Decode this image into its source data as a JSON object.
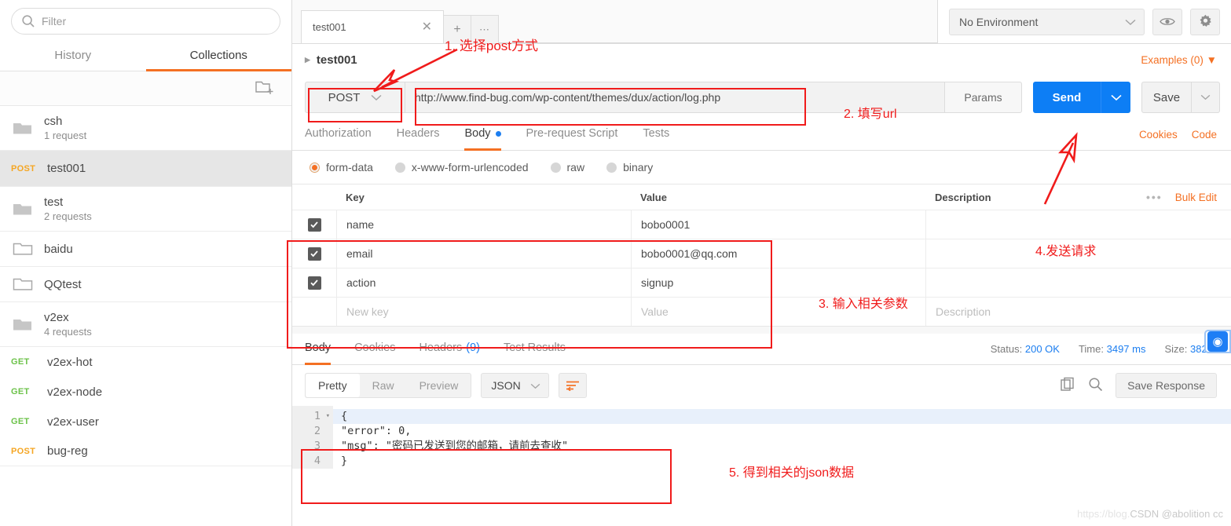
{
  "sidebar": {
    "filter_placeholder": "Filter",
    "tabs": [
      {
        "label": "History",
        "active": false
      },
      {
        "label": "Collections",
        "active": true
      }
    ],
    "new_folder_icon": "new-folder-icon",
    "items": [
      {
        "type": "folder",
        "name": "csh",
        "sub": "1 request"
      },
      {
        "type": "request",
        "method": "POST",
        "name": "test001",
        "selected": true
      },
      {
        "type": "folder",
        "name": "test",
        "sub": "2 requests"
      },
      {
        "type": "folder",
        "name": "baidu",
        "sub": ""
      },
      {
        "type": "folder",
        "name": "QQtest",
        "sub": ""
      },
      {
        "type": "folder",
        "name": "v2ex",
        "sub": "4 requests"
      },
      {
        "type": "request",
        "method": "GET",
        "name": "v2ex-hot",
        "selected": false
      },
      {
        "type": "request",
        "method": "GET",
        "name": "v2ex-node",
        "selected": false
      },
      {
        "type": "request",
        "method": "GET",
        "name": "v2ex-user",
        "selected": false
      },
      {
        "type": "request",
        "method": "POST",
        "name": "bug-reg",
        "selected": false
      }
    ]
  },
  "topbar": {
    "tab_label": "test001",
    "close_icon": "close-icon",
    "new_tab_icon": "plus-icon",
    "more_tabs_icon": "ellipsis-icon",
    "environment": "No Environment",
    "eye_icon": "eye-icon",
    "settings_icon": "gear-icon"
  },
  "request": {
    "breadcrumb": "test001",
    "examples_label": "Examples (0)",
    "method": "POST",
    "url": "http://www.find-bug.com/wp-content/themes/dux/action/log.php",
    "params_label": "Params",
    "send_label": "Send",
    "save_label": "Save",
    "tabs": [
      {
        "label": "Authorization",
        "active": false,
        "dot": false
      },
      {
        "label": "Headers",
        "active": false,
        "dot": false
      },
      {
        "label": "Body",
        "active": true,
        "dot": true
      },
      {
        "label": "Pre-request Script",
        "active": false,
        "dot": false
      },
      {
        "label": "Tests",
        "active": false,
        "dot": false
      }
    ],
    "right_links": [
      "Cookies",
      "Code"
    ],
    "body_types": [
      {
        "label": "form-data",
        "selected": true
      },
      {
        "label": "x-www-form-urlencoded",
        "selected": false
      },
      {
        "label": "raw",
        "selected": false
      },
      {
        "label": "binary",
        "selected": false
      }
    ],
    "table": {
      "headers": [
        "Key",
        "Value",
        "Description"
      ],
      "more_icon": "ellipsis-icon",
      "bulk_edit_label": "Bulk Edit",
      "rows": [
        {
          "checked": true,
          "key": "name",
          "value": "bobo0001",
          "description": ""
        },
        {
          "checked": true,
          "key": "email",
          "value": "bobo0001@qq.com",
          "description": ""
        },
        {
          "checked": true,
          "key": "action",
          "value": "signup",
          "description": ""
        }
      ],
      "new_row": {
        "key_placeholder": "New key",
        "value_placeholder": "Value",
        "desc_placeholder": "Description"
      }
    }
  },
  "response": {
    "tabs": [
      {
        "label": "Body",
        "active": true,
        "count": ""
      },
      {
        "label": "Cookies",
        "active": false,
        "count": ""
      },
      {
        "label": "Headers",
        "active": false,
        "count": "(9)"
      },
      {
        "label": "Test Results",
        "active": false,
        "count": ""
      }
    ],
    "status_label": "Status:",
    "status_value": "200 OK",
    "time_label": "Time:",
    "time_value": "3497 ms",
    "size_label": "Size:",
    "size_value": "382 B",
    "view_modes": [
      {
        "label": "Pretty",
        "active": true
      },
      {
        "label": "Raw",
        "active": false
      },
      {
        "label": "Preview",
        "active": false
      }
    ],
    "format": "JSON",
    "wrap_icon": "wrap-lines-icon",
    "copy_icon": "copy-icon",
    "search_icon": "search-icon",
    "save_response_label": "Save Response",
    "body_lines": [
      {
        "num": "1",
        "fold": true,
        "text": "{"
      },
      {
        "num": "2",
        "fold": false,
        "text": "    \"error\": 0,"
      },
      {
        "num": "3",
        "fold": false,
        "text": "    \"msg\": \"密码已发送到您的邮箱，请前去查收\""
      },
      {
        "num": "4",
        "fold": false,
        "text": "}"
      }
    ]
  },
  "annotations": [
    {
      "id": "a1",
      "text": "1. 选择post方式"
    },
    {
      "id": "a2",
      "text": "2. 填写url"
    },
    {
      "id": "a3",
      "text": "3. 输入相关参数"
    },
    {
      "id": "a4",
      "text": "4.发送请求"
    },
    {
      "id": "a5",
      "text": "5. 得到相关的json数据"
    }
  ],
  "watermark": {
    "faint": "https://blog.",
    "text": "CSDN @abolition cc"
  },
  "colors": {
    "accent_orange": "#f47023",
    "send_blue": "#0d7ef5",
    "annotation_red": "#f01b1b",
    "get_green": "#6cc24a",
    "post_orange": "#f5a623"
  }
}
